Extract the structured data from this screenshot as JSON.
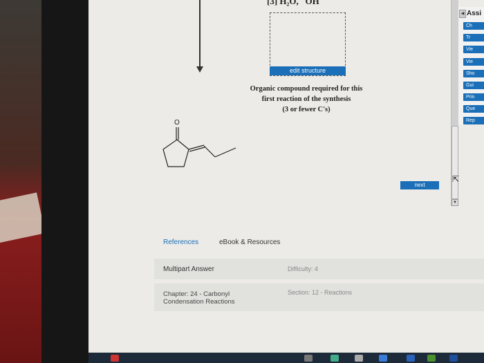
{
  "reagent_text": "[3] H₂O, ¯OH",
  "structure": {
    "edit_label": "edit structure",
    "caption_lines": [
      "Organic compound required for this",
      "first reaction of the synthesis",
      "(3 or fewer C's)"
    ]
  },
  "molecule": {
    "atom_label": "O"
  },
  "next_label": "next",
  "side_panel": {
    "title": "Assi",
    "buttons": [
      "Ch",
      "Tr",
      "Vie",
      "Vie",
      "Sho",
      "Gui",
      "Prin",
      "Que",
      "Rep"
    ],
    "accent": "#1b6fb8"
  },
  "resources": {
    "references": "References",
    "ebook": "eBook & Resources"
  },
  "question_info": {
    "type": "Multipart Answer",
    "difficulty": "Difficulty: 4",
    "chapter": "Chapter: 24 - Carbonyl Condensation Reactions",
    "section": "Section: 12 - Reactions"
  },
  "icons": [
    "arrow-down-icon",
    "cursor-icon",
    "scroll-up-icon",
    "scroll-down-icon"
  ]
}
